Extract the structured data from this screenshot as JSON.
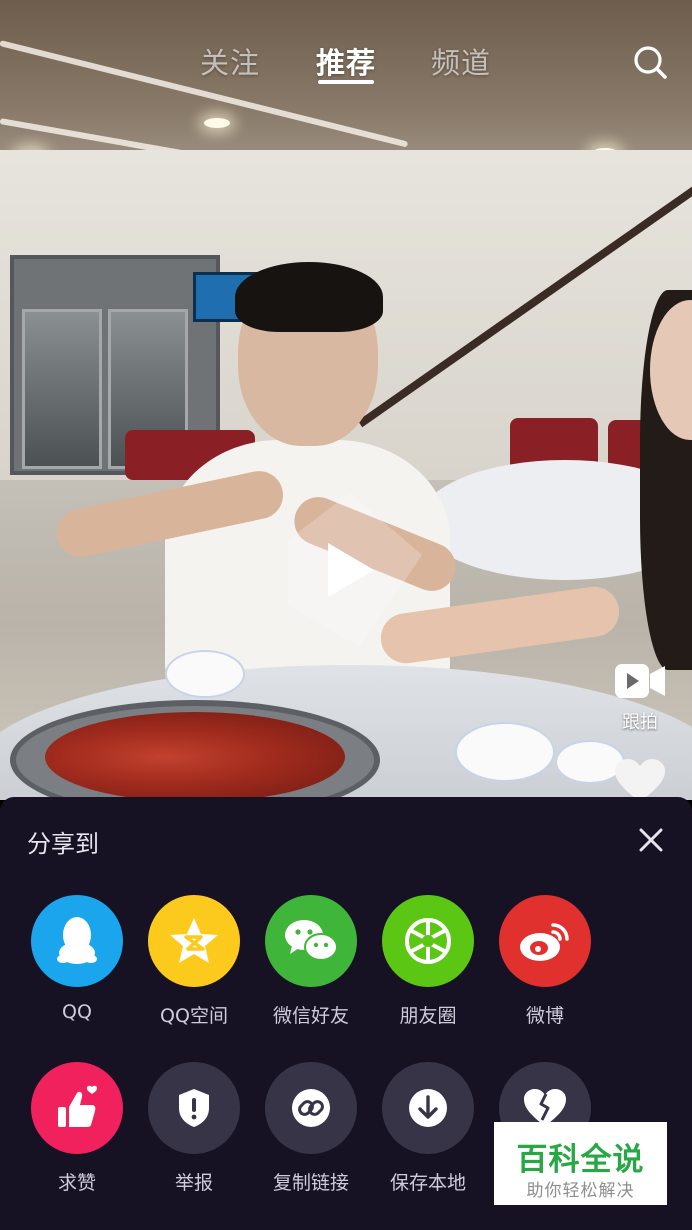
{
  "top_nav": {
    "tabs": [
      {
        "label": "关注",
        "active": false
      },
      {
        "label": "推荐",
        "active": true
      },
      {
        "label": "频道",
        "active": false
      }
    ],
    "search_icon": "search-icon"
  },
  "video": {
    "play_icon": "play-icon"
  },
  "right_rail": {
    "duet_label": "跟拍",
    "duet_icon": "video-camera-icon",
    "like_icon": "heart-icon"
  },
  "share_sheet": {
    "title": "分享到",
    "close_icon": "close-icon",
    "row1": [
      {
        "label": "QQ",
        "icon": "qq-penguin-icon",
        "color": "#1ba5ec"
      },
      {
        "label": "QQ空间",
        "icon": "qzone-star-icon",
        "color": "#fcca1d"
      },
      {
        "label": "微信好友",
        "icon": "wechat-icon",
        "color": "#3fb53a"
      },
      {
        "label": "朋友圈",
        "icon": "moments-aperture-icon",
        "color": "#5cc614"
      },
      {
        "label": "微博",
        "icon": "weibo-icon",
        "color": "#e0312f"
      }
    ],
    "row2": [
      {
        "label": "求赞",
        "icon": "thumbs-up-heart-icon",
        "color": "#f0215c"
      },
      {
        "label": "举报",
        "icon": "shield-alert-icon",
        "color": "#373447"
      },
      {
        "label": "复制链接",
        "icon": "link-icon",
        "color": "#373447"
      },
      {
        "label": "保存本地",
        "icon": "download-icon",
        "color": "#373447"
      },
      {
        "label": "",
        "icon": "broken-heart-icon",
        "color": "#373447"
      }
    ]
  },
  "watermark": {
    "title": "百科全说",
    "subtitle": "助你轻松解决"
  }
}
